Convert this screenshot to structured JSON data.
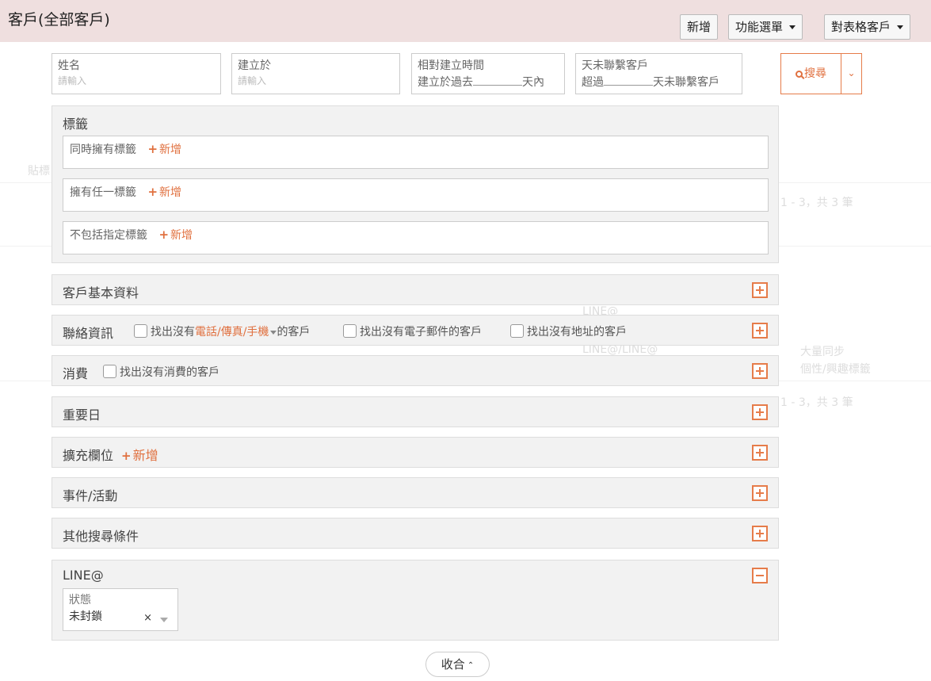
{
  "header": {
    "title": "客戶(全部客戶)",
    "buttons": {
      "add": "新增",
      "menu": "功能選單",
      "table": "對表格客戶"
    }
  },
  "fields": [
    {
      "label": "姓名",
      "placeholder": "請輸入"
    },
    {
      "label": "建立於",
      "placeholder": "請輸入"
    },
    {
      "label": "相對建立時間",
      "prefix": "建立於過去",
      "suffix": "天內"
    },
    {
      "label": "天未聯繫客戶",
      "prefix": "超過",
      "suffix": "天未聯繫客戶"
    }
  ],
  "search": {
    "label": "搜尋"
  },
  "tags": {
    "title": "標籤",
    "add_label": "新增",
    "rows": [
      "同時擁有標籤",
      "擁有任一標籤",
      "不包括指定標籤"
    ]
  },
  "sections": {
    "basic": {
      "title": "客戶基本資料"
    },
    "contact": {
      "title": "聯絡資訊",
      "opt1_prefix": "找出沒有",
      "opt1_fields": "電話/傳真/手機",
      "opt1_suffix": "的客戶",
      "opt2": "找出沒有電子郵件的客戶",
      "opt3": "找出沒有地址的客戶"
    },
    "spend": {
      "title": "消費",
      "opt": "找出沒有消費的客戶"
    },
    "dates": {
      "title": "重要日"
    },
    "ext": {
      "title": "擴充欄位",
      "add": "新增"
    },
    "events": {
      "title": "事件/活動"
    },
    "other": {
      "title": "其他搜尋條件"
    },
    "line": {
      "title": "LINE@",
      "status_label": "狀態",
      "status_value": "未封鎖",
      "clear": "×"
    }
  },
  "collapse": {
    "label": "收合"
  },
  "background": {
    "tab_label": "貼標",
    "pagination_1": "1 - 3，共 3 筆",
    "pagination_2": "1 - 3，共 3 筆",
    "chips": [
      "LINE@",
      "LINE@",
      "LINE@/LINE@"
    ],
    "misc": [
      "大量同步",
      "個性/興趣標籤"
    ]
  }
}
